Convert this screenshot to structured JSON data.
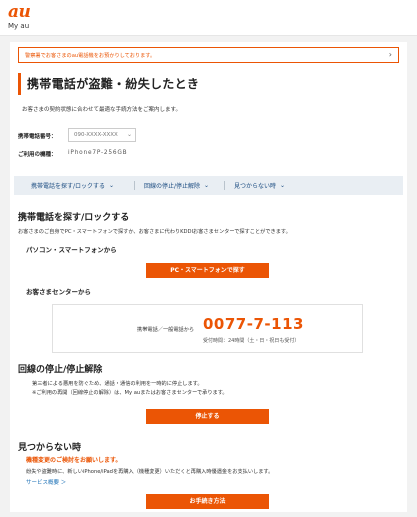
{
  "header": {
    "logo": "au",
    "brand_sub": "My au"
  },
  "notice": {
    "text": "警察署でお客さまのau電話機をお預かりしております。",
    "arrow": "›"
  },
  "page": {
    "title": "携帯電話が盗難・紛失したとき",
    "intro": "お客さまの契約状態に合わせて最適な手続方法をご案内します。"
  },
  "fields": {
    "phone_label": "携帯電話番号：",
    "phone_value": "090-XXXX-XXXX",
    "model_label": "ご利用の機種：",
    "model_value": "iPhone7P-256GB"
  },
  "tabs": [
    {
      "label": "携帯電話を探す/ロックする"
    },
    {
      "label": "回線の停止/停止解除"
    },
    {
      "label": "見つからない時"
    }
  ],
  "find_section": {
    "title": "携帯電話を探す/ロックする",
    "desc": "お客さまのご自身でPC・スマートフォンで探すか、お客さまに代わりKDDIお客さまセンターで探すことができます。",
    "pc_title": "パソコン・スマートフォンから",
    "pc_button": "PC・スマートフォンで探す",
    "center_title": "お客さまセンターから",
    "center_label": "携帯電話／一般電話から",
    "center_number": "0077-7-113",
    "center_hours": "受付時間：24時間（土・日・祝日も受付）"
  },
  "stop_section": {
    "title": "回線の停止/停止解除",
    "desc1": "第三者による悪用を防ぐため、通話・通信の利用を一時的に停止します。",
    "desc2": "※ご利用の再開（回線停止の解除）は、My auまたはお客さまセンターで承ります。",
    "button": "停止する"
  },
  "notfound_section": {
    "title": "見つからない時",
    "warning": "機種変更のご検討をお願いします。",
    "desc": "紛失や盗難時に、新しいiPhone/iPadを再購入（機種変更）いただくと再購入時優遇金をお支払いします。",
    "link": "サービス概要 ＞",
    "button": "お手続き方法"
  },
  "colors": {
    "accent": "#eb5505",
    "tab_bg": "#e9eef3",
    "link": "#1a6fb5"
  }
}
